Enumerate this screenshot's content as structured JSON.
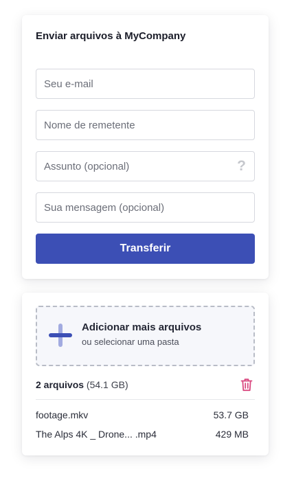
{
  "form": {
    "title": "Enviar arquivos à MyCompany",
    "email_placeholder": "Seu e-mail",
    "sender_placeholder": "Nome de remetente",
    "subject_placeholder": "Assunto (opcional)",
    "message_placeholder": "Sua mensagem (opcional)",
    "help_glyph": "?",
    "submit_label": "Transferir",
    "accent_color": "#3c4fb5"
  },
  "files": {
    "add_title": "Adicionar mais arquivos",
    "add_subtitle": "ou selecionar uma pasta",
    "count_label": "2 arquivos",
    "total_size": "(54.1 GB)",
    "trash_color": "#d9477f",
    "items": [
      {
        "name": "footage.mkv",
        "size": "53.7 GB"
      },
      {
        "name": "The Alps 4K _ Drone... .mp4",
        "size": "429 MB"
      }
    ]
  }
}
